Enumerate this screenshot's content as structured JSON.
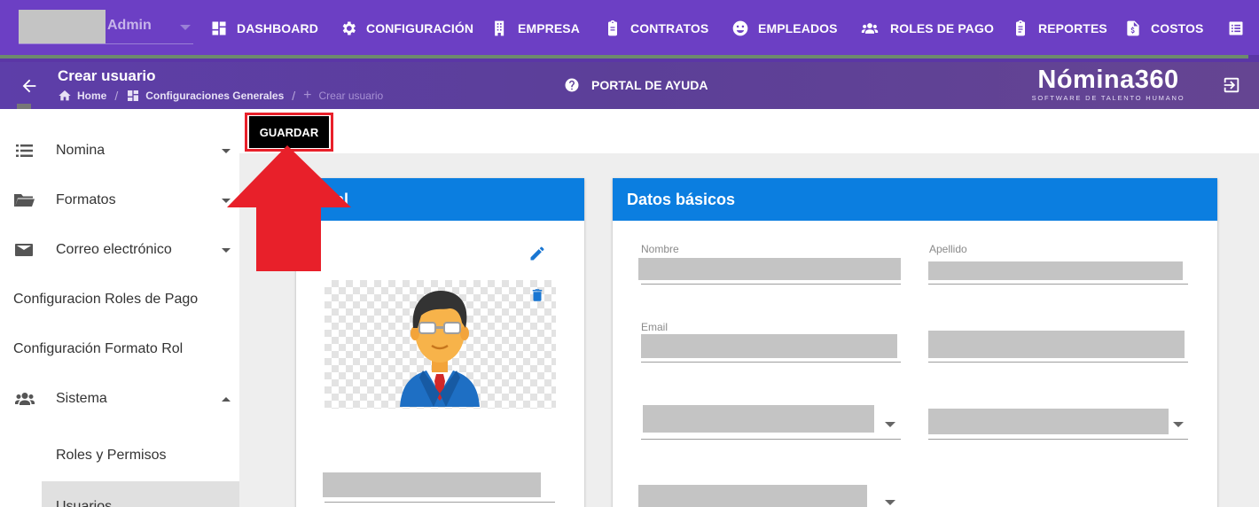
{
  "header": {
    "user_label": "Admin",
    "nav": [
      {
        "label": "DASHBOARD",
        "icon": "dashboard-icon"
      },
      {
        "label": "CONFIGURACIÓN",
        "icon": "gear-icon"
      },
      {
        "label": "EMPRESA",
        "icon": "building-icon"
      },
      {
        "label": "CONTRATOS",
        "icon": "clipboard-icon"
      },
      {
        "label": "EMPLEADOS",
        "icon": "face-icon"
      },
      {
        "label": "ROLES DE PAGO",
        "icon": "users-icon"
      },
      {
        "label": "REPORTES",
        "icon": "report-icon"
      },
      {
        "label": "COSTOS",
        "icon": "invoice-icon"
      }
    ]
  },
  "subheader": {
    "title": "Crear usuario",
    "breadcrumb": {
      "home": "Home",
      "section": "Configuraciones Generales",
      "current": "Crear usuario"
    },
    "help_label": "PORTAL DE AYUDA",
    "logo_name": "Nómina360",
    "logo_tagline": "SOFTWARE DE TALENTO HUMANO"
  },
  "sidebar": {
    "items": [
      {
        "label": "Nomina",
        "icon": "list-icon"
      },
      {
        "label": "Formatos",
        "icon": "folder-icon"
      },
      {
        "label": "Correo electrónico",
        "icon": "mail-icon"
      },
      {
        "label": "Configuracion Roles de Pago"
      },
      {
        "label": "Configuración Formato Rol"
      },
      {
        "label": "Sistema",
        "icon": "users-icon"
      },
      {
        "label": "Roles y Permisos"
      },
      {
        "label": "Usuarios"
      }
    ]
  },
  "toolbar": {
    "save_label": "GUARDAR"
  },
  "profile_card": {
    "title_visible": "al"
  },
  "basic_card": {
    "title": "Datos básicos",
    "name_label": "Nombre",
    "lastname_label": "Apellido",
    "email_label": "Email"
  },
  "colors": {
    "nav_bg": "#6c3fc4",
    "card_header": "#0b7ee0",
    "highlight": "#e8202a"
  }
}
